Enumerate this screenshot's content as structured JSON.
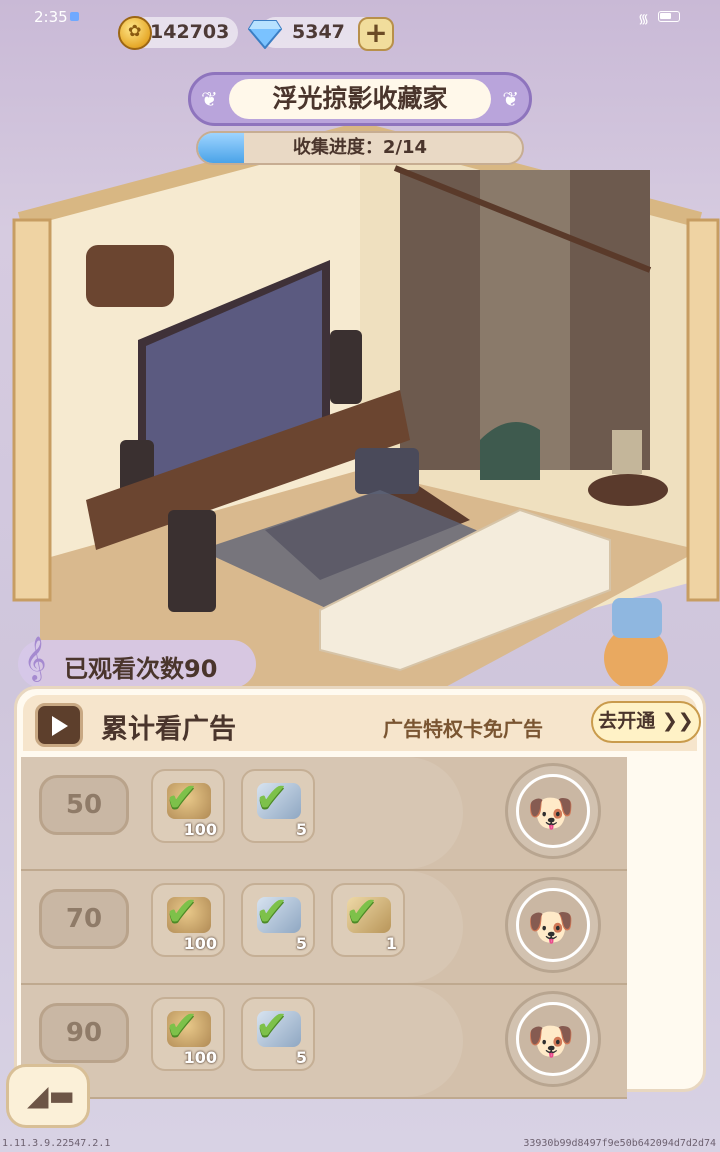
{
  "status_bar": {
    "time": "2:35"
  },
  "currency": {
    "coins": "142703",
    "gems": "5347",
    "add_label": "+"
  },
  "title": "浮光掠影收藏家",
  "progress": {
    "label": "收集进度：2/14",
    "fraction": 0.143
  },
  "views_label": "已观看次数90",
  "panel": {
    "title": "累计看广告",
    "privilege_text": "广告特权卡免广告",
    "open_button": "去开通 ❯❯",
    "rows": [
      {
        "count": "50",
        "rewards": [
          {
            "icon": "coin-pile-icon",
            "qty": "100"
          },
          {
            "icon": "gem-pile-icon",
            "qty": "5"
          }
        ]
      },
      {
        "count": "70",
        "rewards": [
          {
            "icon": "coin-pile-icon",
            "qty": "100"
          },
          {
            "icon": "gem-pile-icon",
            "qty": "5"
          },
          {
            "icon": "star-item-icon",
            "qty": "1"
          }
        ]
      },
      {
        "count": "90",
        "rewards": [
          {
            "icon": "coin-pile-icon",
            "qty": "100"
          },
          {
            "icon": "gem-pile-icon",
            "qty": "5"
          }
        ]
      }
    ]
  },
  "footer": {
    "version": "1.11.3.9.22547.2.1",
    "hash": "33930b99d8497f9e50b642094d7d2d74"
  },
  "colors": {
    "accent_purple": "#8e74bd",
    "check_green": "#7dc14a",
    "panel_bg": "#fffaf0"
  }
}
